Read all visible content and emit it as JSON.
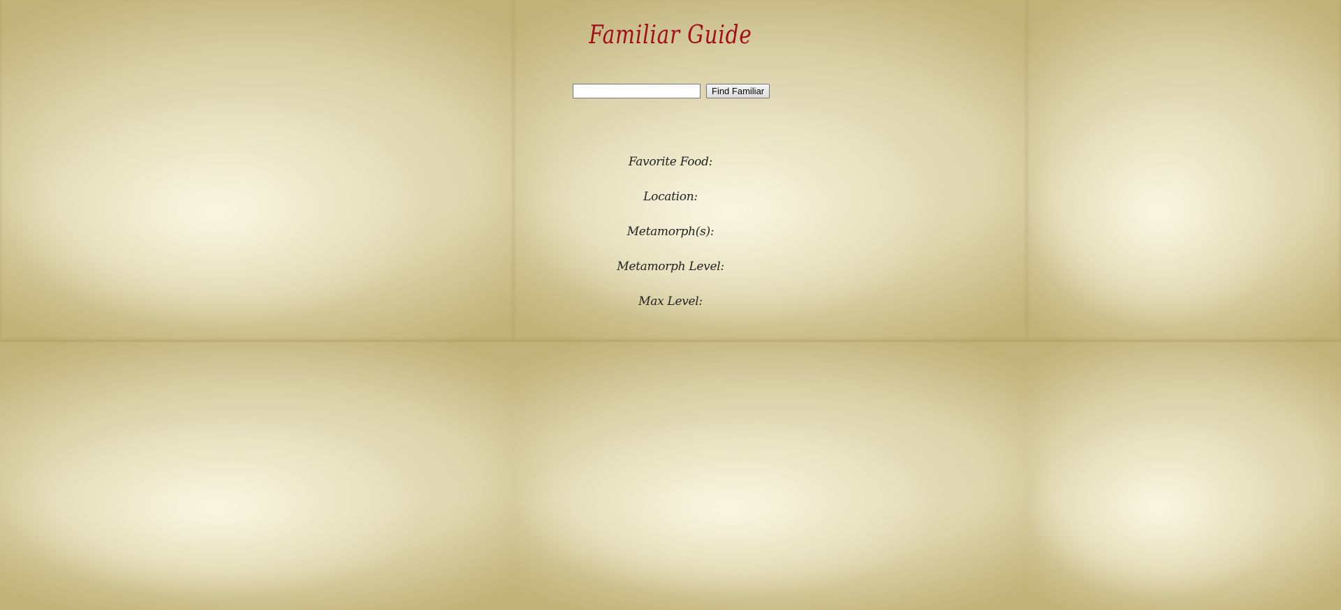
{
  "page": {
    "title": "Familiar Guide"
  },
  "search": {
    "value": "",
    "placeholder": "",
    "button_label": "Find Familiar"
  },
  "fields": {
    "favorite_food": "Favorite Food:",
    "location": "Location:",
    "metamorphs": "Metamorph(s):",
    "metamorph_level": "Metamorph Level:",
    "max_level": "Max Level:"
  },
  "colors": {
    "title": "#a10e1a",
    "background": "#e3dcb8",
    "text": "#222222"
  }
}
